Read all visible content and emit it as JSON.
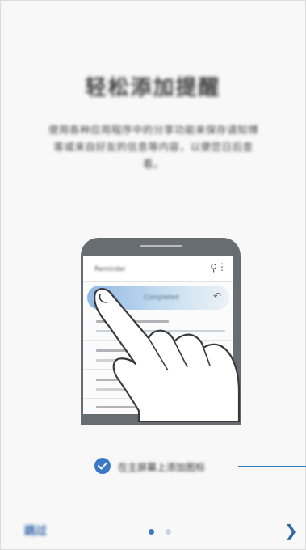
{
  "onboarding": {
    "title": "轻松添加提醒",
    "description": "使用各种应用程序中的分享功能来保存请知博客或来自好友的信息等内容，以便您日后查看。",
    "checkbox": {
      "checked": true,
      "label": "在主屏幕上添加图标"
    },
    "skip_label": "跳过",
    "page_indicator": {
      "current": 1,
      "total": 2
    },
    "next_icon": "chevron-right-icon"
  },
  "illustration": {
    "app_bar_title": "Reminder",
    "highlighted_item_text": "Completed",
    "search_icon": "search-icon",
    "more_icon": "more-vert-icon",
    "undo_icon": "undo-icon"
  },
  "colors": {
    "accent": "#3b79c6",
    "phone_body": "#686d72",
    "callout_line": "#2d7fc0"
  }
}
